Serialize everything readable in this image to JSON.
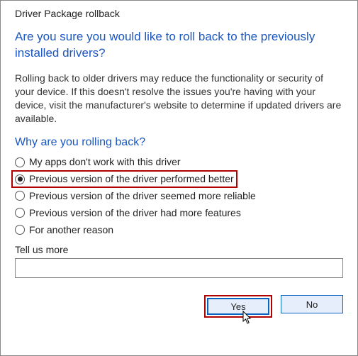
{
  "window": {
    "title": "Driver Package rollback"
  },
  "heading": "Are you sure you would like to roll back to the previously installed drivers?",
  "body": "Rolling back to older drivers may reduce the functionality or security of your device.  If this doesn't resolve the issues you're having with your device, visit the manufacturer's website to determine if updated drivers are available.",
  "subheading": "Why are you rolling back?",
  "reasons": {
    "0": {
      "label": "My apps don't work with this driver"
    },
    "1": {
      "label": "Previous version of the driver performed better"
    },
    "2": {
      "label": "Previous version of the driver seemed more reliable"
    },
    "3": {
      "label": "Previous version of the driver had more features"
    },
    "4": {
      "label": "For another reason"
    }
  },
  "selected_reason_index": 1,
  "tellus": {
    "label": "Tell us more",
    "value": ""
  },
  "buttons": {
    "yes": "Yes",
    "no": "No"
  }
}
